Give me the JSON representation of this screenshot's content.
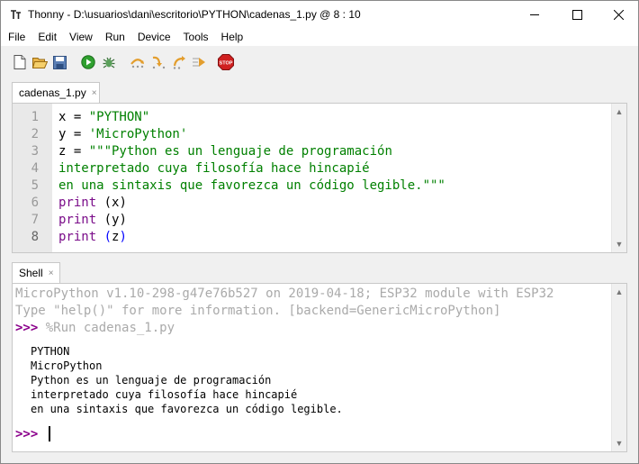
{
  "window": {
    "title": "Thonny  -  D:\\usuarios\\dani\\escritorio\\PYTHON\\cadenas_1.py  @  8 : 10",
    "logo_icon": "thonny-logo-icon",
    "controls": [
      "minimize-icon",
      "maximize-icon",
      "close-icon"
    ]
  },
  "menu": {
    "items": [
      {
        "label": "File"
      },
      {
        "label": "Edit"
      },
      {
        "label": "View"
      },
      {
        "label": "Run"
      },
      {
        "label": "Device"
      },
      {
        "label": "Tools"
      },
      {
        "label": "Help"
      }
    ]
  },
  "toolbar": {
    "buttons": [
      {
        "icon": "new-file-icon"
      },
      {
        "icon": "open-folder-icon"
      },
      {
        "icon": "save-icon"
      },
      {
        "icon": "run-icon"
      },
      {
        "icon": "debug-icon"
      },
      {
        "icon": "step-over-icon"
      },
      {
        "icon": "step-into-icon"
      },
      {
        "icon": "step-out-icon"
      },
      {
        "icon": "resume-icon"
      },
      {
        "icon": "stop-icon",
        "label": "STOP"
      }
    ]
  },
  "editor": {
    "tab_label": "cadenas_1.py",
    "tab_close": "×",
    "line_numbers": [
      "1",
      "2",
      "3",
      "4",
      "5",
      "6",
      "7",
      "8"
    ],
    "lines": [
      {
        "a": "x = ",
        "b": "\"PYTHON\""
      },
      {
        "a": "y = ",
        "b": "'MicroPython'"
      },
      {
        "a": "z = ",
        "b": "\"\"\"Python es un lenguaje de programación"
      },
      {
        "b": "interpretado cuya filosofía hace hincapié"
      },
      {
        "b": "en una sintaxis que favorezca un código legible.\"\"\""
      },
      {
        "kw": "print",
        "rest": " (x)"
      },
      {
        "kw": "print",
        "rest": " (y)"
      },
      {
        "kw": "print",
        "sp": " ",
        "p1": "(",
        "mid": "z",
        "p2": ")"
      }
    ],
    "colors": {
      "string": "#008000",
      "keyword": "#7a0c89",
      "matched_paren": "#0000ff"
    }
  },
  "shell": {
    "tab_label": "Shell",
    "tab_close": "×",
    "banner": [
      "MicroPython v1.10-298-g47e76b527 on 2019-04-18; ESP32 module with ESP32",
      "Type \"help()\" for more information. [backend=GenericMicroPython]"
    ],
    "prompt": ">>>",
    "run_command": " %Run cadenas_1.py",
    "output": [
      "PYTHON",
      "MicroPython",
      "Python es un lenguaje de programación",
      "interpretado cuya filosofía hace hincapié",
      "en una sintaxis que favorezca un código legible."
    ],
    "prompt_color": "#8b008b"
  }
}
